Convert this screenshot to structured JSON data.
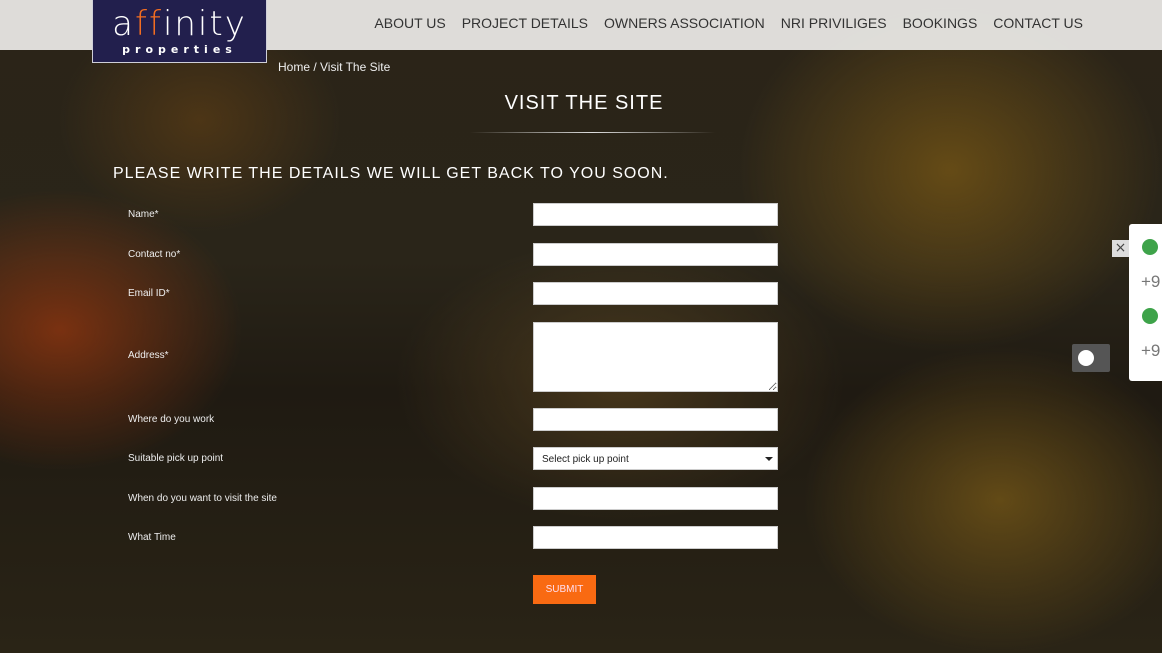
{
  "logo": {
    "main_a": "a",
    "main_ff": "ff",
    "main_rest": "inity",
    "sub": "properties"
  },
  "nav": [
    "ABOUT US",
    "PROJECT DETAILS",
    "OWNERS ASSOCIATION",
    "NRI PRIVILIGES",
    "BOOKINGS",
    "CONTACT US"
  ],
  "breadcrumb": "Home / Visit The Site",
  "title": "VISIT THE SITE",
  "heading": "PLEASE WRITE THE DETAILS WE WILL GET BACK TO YOU SOON.",
  "form": {
    "name": "Name*",
    "contact": "Contact no*",
    "email": "Email ID*",
    "address": "Address*",
    "work": "Where do you work",
    "pickup": "Suitable pick up point",
    "pickup_value": "Select pick up point",
    "when": "When do you want to visit the site",
    "time": "What Time",
    "submit": "SUBMIT"
  },
  "side": {
    "num1": "+9",
    "num2": "+9",
    "close": "×"
  },
  "colors": {
    "accent": "#f96a12",
    "logo_bg": "#221f4d",
    "phone": "#3ea34a"
  }
}
